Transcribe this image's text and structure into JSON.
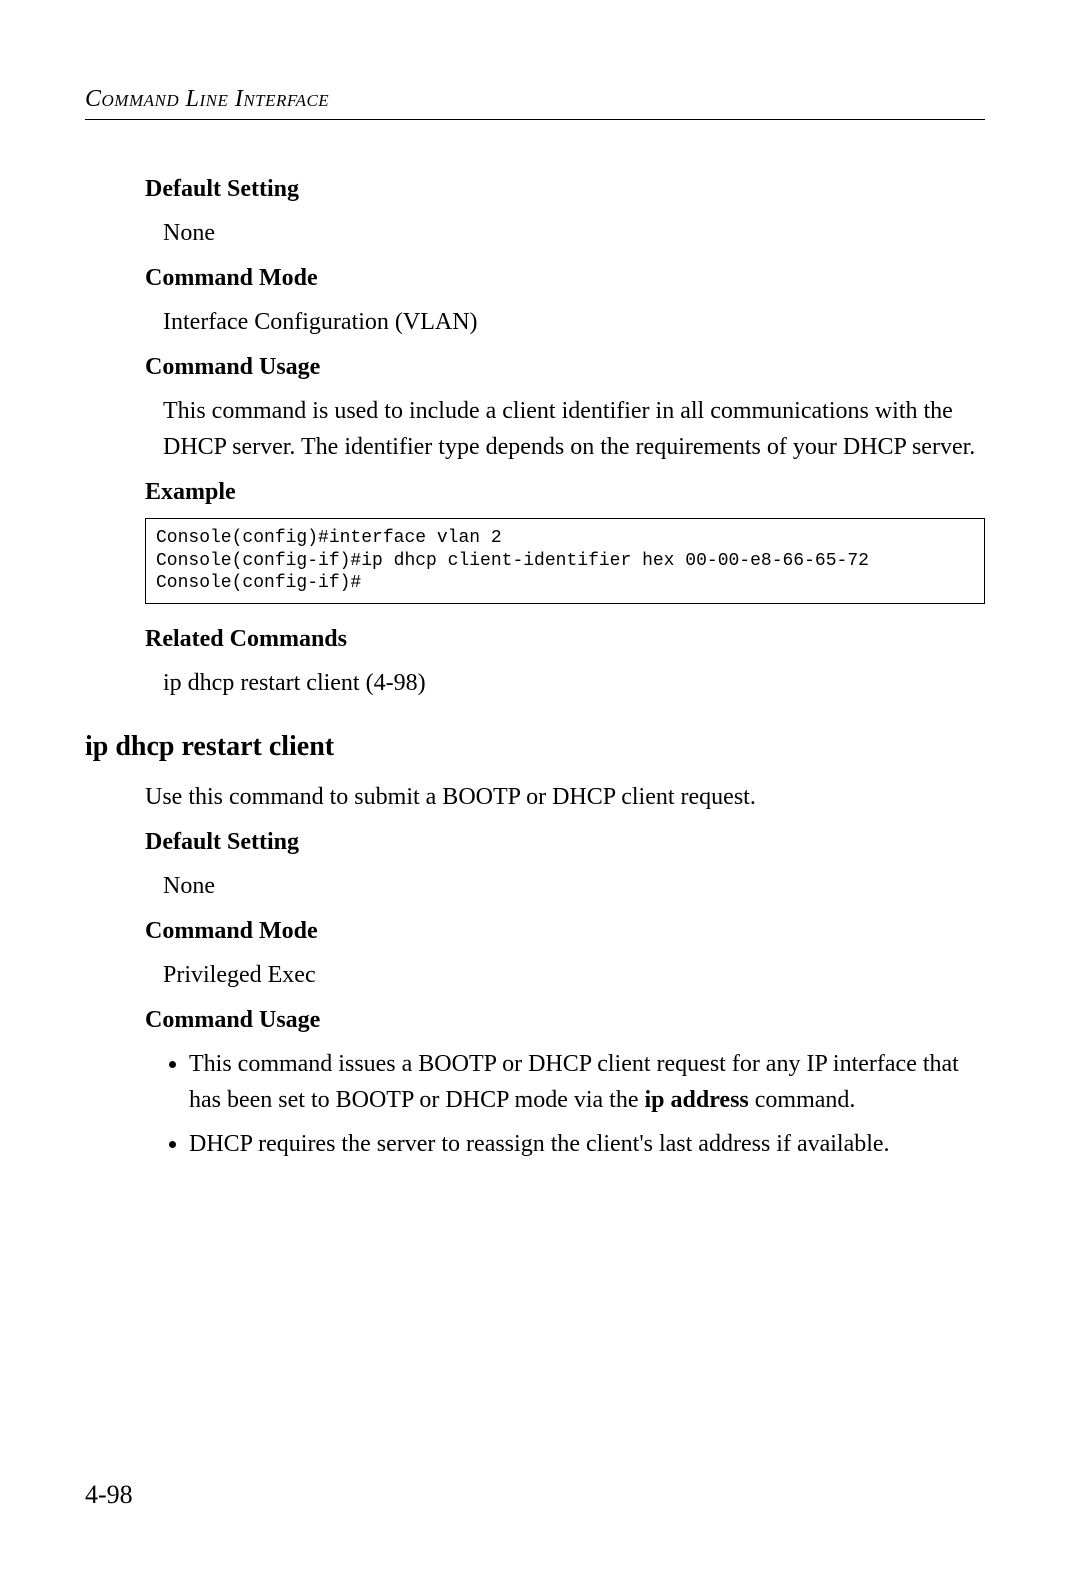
{
  "header": {
    "running_head": "Command Line Interface"
  },
  "block1": {
    "default_setting": {
      "heading": "Default Setting",
      "body": "None"
    },
    "command_mode": {
      "heading": "Command Mode",
      "body": "Interface Configuration (VLAN)"
    },
    "command_usage": {
      "heading": "Command Usage",
      "body": "This command is used to include a client identifier in all communications with the DHCP server. The identifier type depends on the requirements of your DHCP server."
    },
    "example": {
      "heading": "Example",
      "code": "Console(config)#interface vlan 2\nConsole(config-if)#ip dhcp client-identifier hex 00-00-e8-66-65-72\nConsole(config-if)#"
    },
    "related": {
      "heading": "Related Commands",
      "body": "ip dhcp restart client (4-98)"
    }
  },
  "section2": {
    "title": "ip dhcp restart client",
    "intro": "Use this command to submit a BOOTP or DHCP client request.",
    "default_setting": {
      "heading": "Default Setting",
      "body": "None"
    },
    "command_mode": {
      "heading": "Command Mode",
      "body": "Privileged Exec"
    },
    "command_usage": {
      "heading": "Command Usage",
      "bullets": {
        "b1_pre": "This command issues a BOOTP or DHCP client request for any IP interface that has been set to BOOTP or DHCP mode via the ",
        "b1_bold": "ip address",
        "b1_post": " command.",
        "b2": "DHCP requires the server to reassign the client's last address if available."
      }
    }
  },
  "page_number": "4-98"
}
